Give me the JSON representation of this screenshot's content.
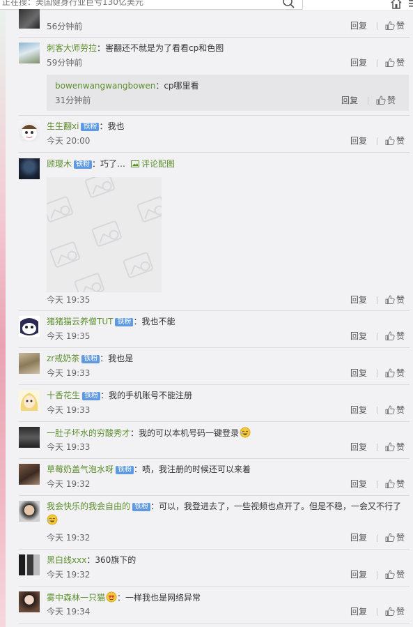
{
  "search": {
    "text": "正在搜：美国健身行业巨亏130亿美元"
  },
  "actions": {
    "reply_label": "回复",
    "like_label": "赞"
  },
  "badge_text": "铁粉",
  "comments": [
    {
      "time": "56分钟前"
    },
    {
      "username": "刺客大师劳拉",
      "text": "：害翻还不就是为了看看cp和色图",
      "time": "59分钟前",
      "sub": {
        "username": "bowenwangwangbowen",
        "text": "：cp哪里看",
        "time": "31分钟前"
      }
    },
    {
      "username": "生生翻xi",
      "badge": true,
      "text": "：我也",
      "time": "今天 20:00"
    },
    {
      "username": "顾璎木",
      "badge": true,
      "text": "：巧了…",
      "image_link": "评论配图",
      "time": "今天 19:35"
    },
    {
      "username": "猪猪猫云养僧TUT",
      "badge": true,
      "text": "：我也不能",
      "time": "今天 19:35"
    },
    {
      "username": "zr戒奶茶",
      "badge": true,
      "text": "：我也是",
      "time": "今天 19:33"
    },
    {
      "username": "十香花生",
      "badge": true,
      "text": "：我的手机账号不能注册",
      "time": "今天 19:33"
    },
    {
      "username": "一肚子坏水的穷酸秀才",
      "text": "：我的可以本机号码一键登录",
      "time": "今天 19:33"
    },
    {
      "username": "草莓奶盖气泡水呀",
      "badge": true,
      "text": "：啧，我注册的时候还可以来着",
      "time": "今天 19:32"
    },
    {
      "username": "我会快乐的我会自由的",
      "badge": true,
      "text": "：可以，我登进去了，一些视频也点开了。但是不稳，一会又不行了",
      "time": "今天 19:32"
    },
    {
      "username": "黑白线xxx",
      "text": "：360旗下的",
      "time": "今天 19:32"
    },
    {
      "username": "雾中森林一只猫",
      "text": "：一样我也是网络异常",
      "time": "今天 19:34"
    }
  ]
}
